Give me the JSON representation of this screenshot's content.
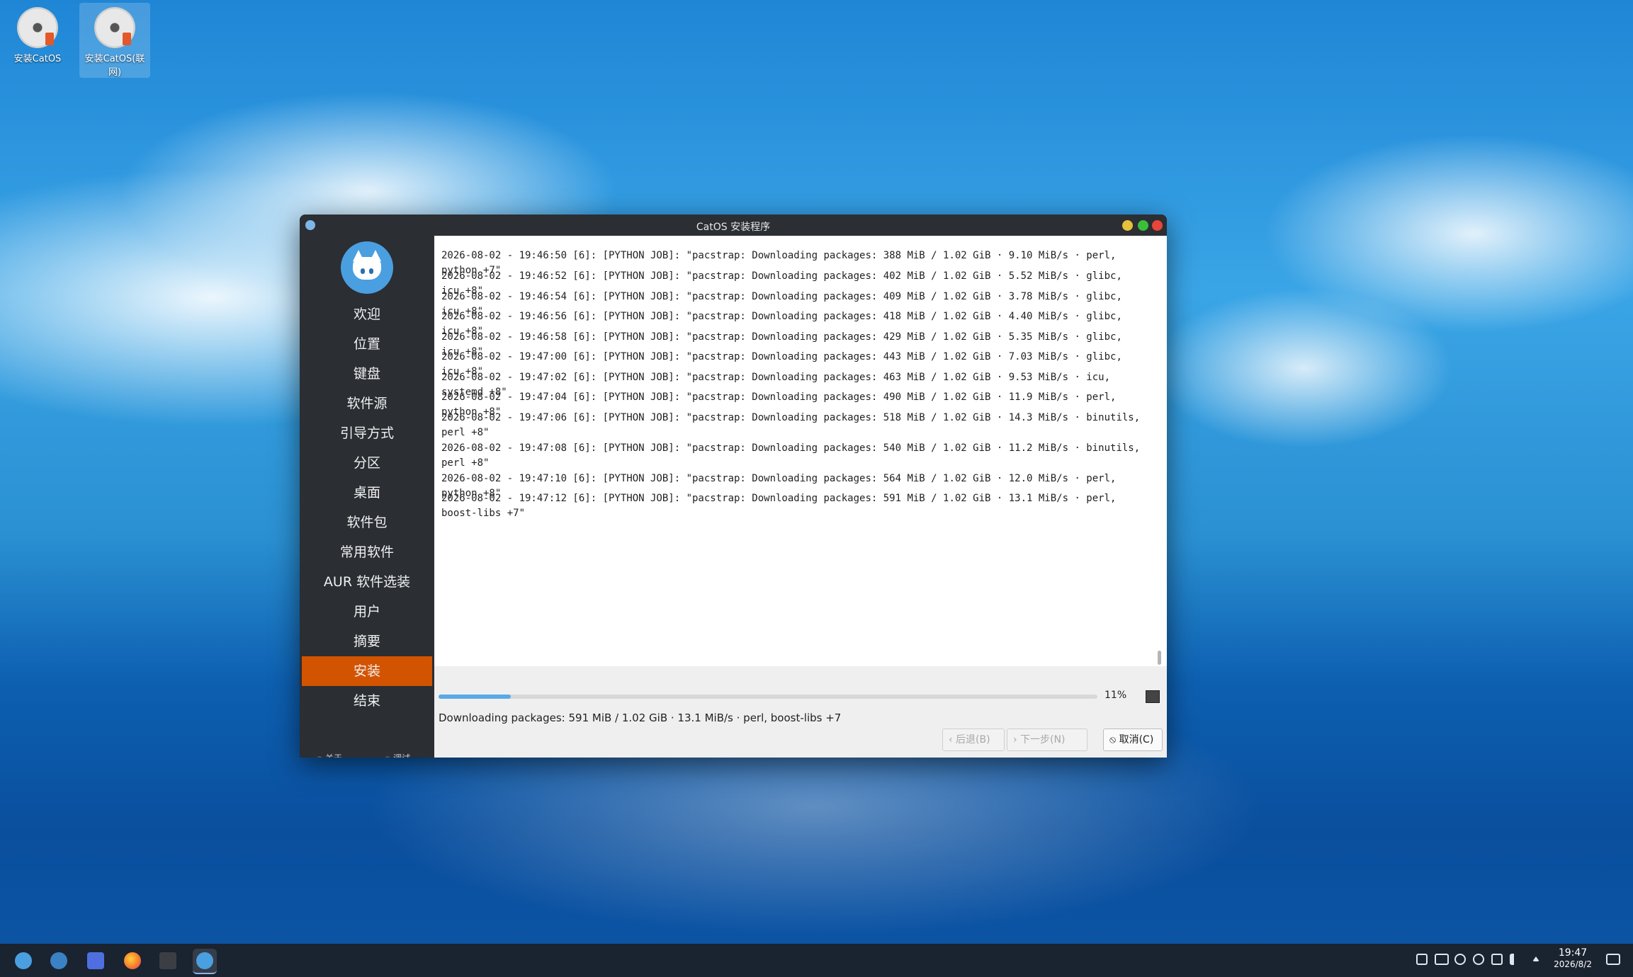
{
  "desktop": {
    "icons": [
      {
        "label": "安装CatOS"
      },
      {
        "label": "安装CatOS(联网)"
      }
    ]
  },
  "window": {
    "title": "CatOS 安装程序"
  },
  "sidebar": {
    "items": [
      "欢迎",
      "位置",
      "键盘",
      "软件源",
      "引导方式",
      "分区",
      "桌面",
      "软件包",
      "常用软件",
      "AUR 软件选装",
      "用户",
      "摘要",
      "安装",
      "结束"
    ],
    "active_index": 12,
    "footer": {
      "about": "关于",
      "debug": "调试"
    }
  },
  "log": {
    "lines": [
      "2026-08-02 - 19:46:50 [6]: [PYTHON JOB]: \"pacstrap: Downloading packages: 388 MiB / 1.02 GiB · 9.10 MiB/s · perl, python +7\"",
      "2026-08-02 - 19:46:52 [6]: [PYTHON JOB]: \"pacstrap: Downloading packages: 402 MiB / 1.02 GiB · 5.52 MiB/s · glibc, icu +8\"",
      "2026-08-02 - 19:46:54 [6]: [PYTHON JOB]: \"pacstrap: Downloading packages: 409 MiB / 1.02 GiB · 3.78 MiB/s · glibc, icu +8\"",
      "2026-08-02 - 19:46:56 [6]: [PYTHON JOB]: \"pacstrap: Downloading packages: 418 MiB / 1.02 GiB · 4.40 MiB/s · glibc, icu +8\"",
      "2026-08-02 - 19:46:58 [6]: [PYTHON JOB]: \"pacstrap: Downloading packages: 429 MiB / 1.02 GiB · 5.35 MiB/s · glibc, icu +8\"",
      "2026-08-02 - 19:47:00 [6]: [PYTHON JOB]: \"pacstrap: Downloading packages: 443 MiB / 1.02 GiB · 7.03 MiB/s · glibc, icu +8\"",
      "2026-08-02 - 19:47:02 [6]: [PYTHON JOB]: \"pacstrap: Downloading packages: 463 MiB / 1.02 GiB · 9.53 MiB/s · icu, systemd +8\"",
      "2026-08-02 - 19:47:04 [6]: [PYTHON JOB]: \"pacstrap: Downloading packages: 490 MiB / 1.02 GiB · 11.9 MiB/s · perl, python +8\"",
      "2026-08-02 - 19:47:06 [6]: [PYTHON JOB]: \"pacstrap: Downloading packages: 518 MiB / 1.02 GiB · 14.3 MiB/s · binutils, perl +8\"",
      "2026-08-02 - 19:47:08 [6]: [PYTHON JOB]: \"pacstrap: Downloading packages: 540 MiB / 1.02 GiB · 11.2 MiB/s · binutils, perl +8\"",
      "2026-08-02 - 19:47:10 [6]: [PYTHON JOB]: \"pacstrap: Downloading packages: 564 MiB / 1.02 GiB · 12.0 MiB/s · perl, python +8\"",
      "2026-08-02 - 19:47:12 [6]: [PYTHON JOB]: \"pacstrap: Downloading packages: 591 MiB / 1.02 GiB · 13.1 MiB/s · perl, boost-libs +7\""
    ]
  },
  "progress": {
    "fraction": 0.11,
    "percent_label": "11%",
    "status": "Downloading packages: 591 MiB / 1.02 GiB · 13.1 MiB/s · perl, boost-libs +7"
  },
  "buttons": {
    "back": "‹ 后退(B)",
    "next": "› 下一步(N)",
    "cancel": "⦸ 取消(C)"
  },
  "taskbar": {
    "apps": [
      {
        "icon": "catos-menu-icon"
      },
      {
        "icon": "toggle-icon"
      },
      {
        "icon": "folder-icon"
      },
      {
        "icon": "firefox-icon"
      },
      {
        "icon": "terminal-icon"
      },
      {
        "icon": "catos-installer-icon"
      }
    ],
    "clock": {
      "time": "19:47",
      "date": "2026/8/2"
    },
    "colors": {
      "accent": "#d35400",
      "progress": "#5aa9e6",
      "taskbar": "#1a2330"
    }
  }
}
